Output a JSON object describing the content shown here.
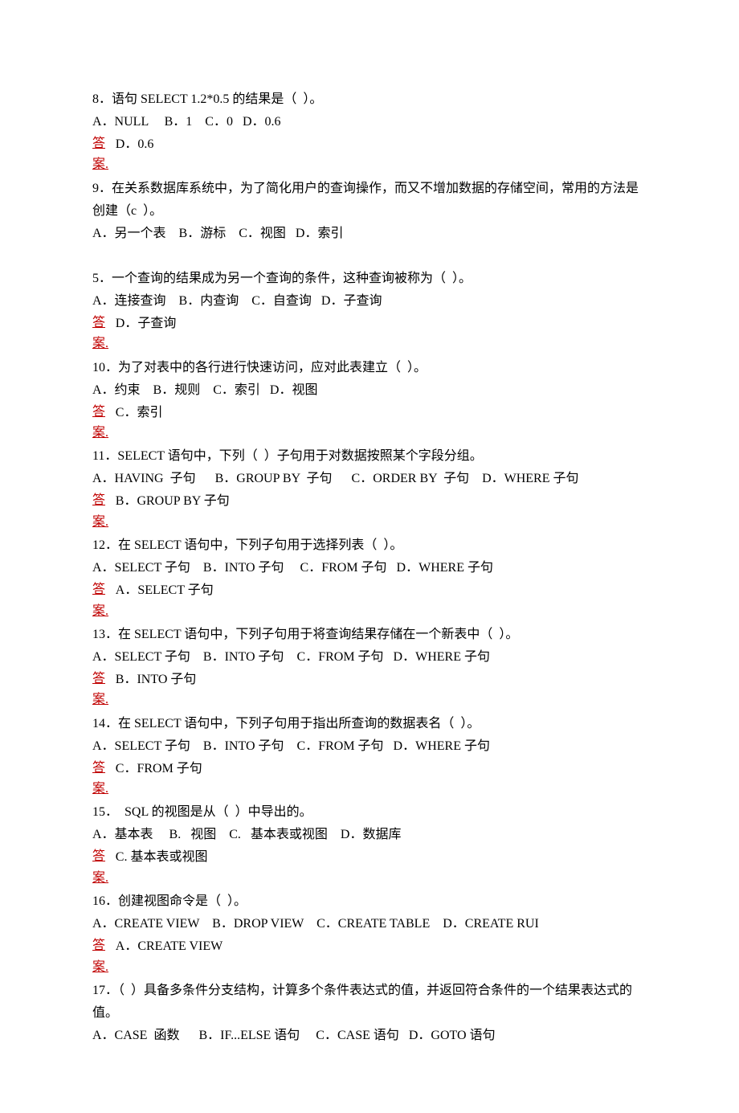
{
  "questions": [
    {
      "q": "8．语句 SELECT 1.2*0.5 的结果是（  ）。",
      "opts": "A．NULL     B．1    C．0   D．0.6",
      "ans": "D．0.6"
    },
    {
      "q": "9．在关系数据库系统中，为了简化用户的查询操作，而又不增加数据的存储空间，常用的方法是创建（c  ）。",
      "opts": "A．另一个表    B．游标    C．视图   D．索引",
      "ans": null
    },
    {
      "q": "5．一个查询的结果成为另一个查询的条件，这种查询被称为（  ）。",
      "opts": "A．连接查询    B．内查询    C．自查询   D．子查询",
      "ans": "D．子查询"
    },
    {
      "q": "10．为了对表中的各行进行快速访问，应对此表建立（  ）。",
      "opts": "A．约束    B．规则    C．索引   D．视图",
      "ans": "C．索引"
    },
    {
      "q": "11．SELECT 语句中，下列（  ）子句用于对数据按照某个字段分组。",
      "opts": "A．HAVING  子句      B．GROUP BY  子句      C．ORDER BY  子句    D．WHERE 子句",
      "ans": "B．GROUP BY  子句"
    },
    {
      "q": "12．在 SELECT 语句中，下列子句用于选择列表（  ）。",
      "opts": "A．SELECT 子句    B．INTO 子句     C．FROM 子句   D．WHERE 子句",
      "ans": "A．SELECT 子句"
    },
    {
      "q": "13．在 SELECT 语句中，下列子句用于将查询结果存储在一个新表中（  ）。",
      "opts": "A．SELECT 子句    B．INTO 子句    C．FROM 子句   D．WHERE 子句",
      "ans": "B．INTO 子句"
    },
    {
      "q": "14．在 SELECT 语句中，下列子句用于指出所查询的数据表名（  ）。",
      "opts": "A．SELECT 子句    B．INTO 子句    C．FROM 子句   D．WHERE 子句",
      "ans": "C．FROM 子句"
    },
    {
      "q": "15．  SQL 的视图是从（  ）中导出的。",
      "opts": "A．基本表     B.   视图    C.   基本表或视图    D．数据库",
      "ans": "C.   基本表或视图"
    },
    {
      "q": "16．创建视图命令是（  ）。",
      "opts": "A．CREATE VIEW    B．DROP VIEW    C．CREATE TABLE    D．CREATE RUI",
      "ans": "A．CREATE VIEW"
    },
    {
      "q": "17．（  ）具备多条件分支结构，计算多个条件表达式的值，并返回符合条件的一个结果表达式的值。",
      "opts": "A．CASE  函数      B．IF...ELSE 语句     C．CASE 语句   D．GOTO 语句",
      "ans": null
    }
  ],
  "answer_label_char1": "答",
  "answer_label_char2": "案."
}
